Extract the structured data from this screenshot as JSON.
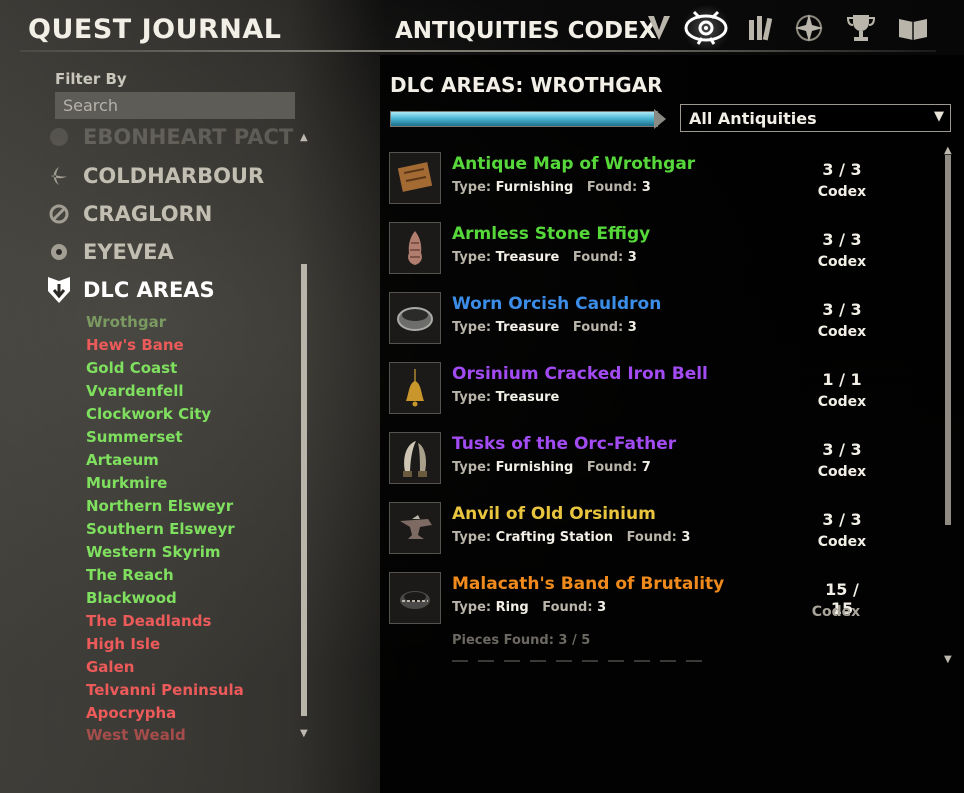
{
  "header": {
    "title": "QUEST JOURNAL",
    "codex_title": "ANTIQUITIES CODEX",
    "tabs": [
      {
        "icon": "quest-shield-icon"
      },
      {
        "icon": "antiquities-eye-icon",
        "active": true
      },
      {
        "icon": "lore-books-icon"
      },
      {
        "icon": "compass-star-icon"
      },
      {
        "icon": "trophy-icon"
      },
      {
        "icon": "open-book-icon"
      }
    ]
  },
  "filter": {
    "label": "Filter By",
    "search_placeholder": "Search"
  },
  "categories": [
    {
      "label": "EBONHEART PACT",
      "icon": "ebonheart-icon",
      "state": "faded"
    },
    {
      "label": "COLDHARBOUR",
      "icon": "coldharbour-icon"
    },
    {
      "label": "CRAGLORN",
      "icon": "craglorn-icon"
    },
    {
      "label": "EYEVEA",
      "icon": "eyevea-icon"
    },
    {
      "label": "DLC AREAS",
      "icon": "dlc-shield-icon",
      "state": "selected"
    }
  ],
  "zones": [
    {
      "label": "Wrothgar",
      "color": "selected"
    },
    {
      "label": "Hew's Bane",
      "color": "red"
    },
    {
      "label": "Gold Coast",
      "color": "green"
    },
    {
      "label": "Vvardenfell",
      "color": "green"
    },
    {
      "label": "Clockwork City",
      "color": "green"
    },
    {
      "label": "Summerset",
      "color": "green"
    },
    {
      "label": "Artaeum",
      "color": "green"
    },
    {
      "label": "Murkmire",
      "color": "green"
    },
    {
      "label": "Northern Elsweyr",
      "color": "green"
    },
    {
      "label": "Southern Elsweyr",
      "color": "green"
    },
    {
      "label": "Western Skyrim",
      "color": "green"
    },
    {
      "label": "The Reach",
      "color": "green"
    },
    {
      "label": "Blackwood",
      "color": "green"
    },
    {
      "label": "The Deadlands",
      "color": "red"
    },
    {
      "label": "High Isle",
      "color": "red"
    },
    {
      "label": "Galen",
      "color": "red"
    },
    {
      "label": "Telvanni Peninsula",
      "color": "red"
    },
    {
      "label": "Apocrypha",
      "color": "red"
    },
    {
      "label": "West Weald",
      "color": "red"
    }
  ],
  "main": {
    "section_title": "DLC AREAS: WROTHGAR",
    "progress_fraction": 1.0,
    "dropdown_value": "All Antiquities",
    "type_label": "Type:",
    "found_label": "Found:",
    "items": [
      {
        "name": "Antique Map of Wrothgar",
        "color": "#56d83a",
        "type": "Furnishing",
        "found": "3",
        "count": "3 / 3",
        "codex": "Codex",
        "thumb": "map-icon"
      },
      {
        "name": "Armless Stone Effigy",
        "color": "#56d83a",
        "type": "Treasure",
        "found": "3",
        "count": "3 / 3",
        "codex": "Codex",
        "thumb": "effigy-icon"
      },
      {
        "name": "Worn Orcish Cauldron",
        "color": "#3b8de8",
        "type": "Treasure",
        "found": "3",
        "count": "3 / 3",
        "codex": "Codex",
        "thumb": "cauldron-icon"
      },
      {
        "name": "Orsinium Cracked Iron Bell",
        "color": "#a24bf2",
        "type": "Treasure",
        "found": null,
        "count": "1 / 1",
        "codex": "Codex",
        "thumb": "bell-icon"
      },
      {
        "name": "Tusks of the Orc-Father",
        "color": "#a24bf2",
        "type": "Furnishing",
        "found": "7",
        "count": "3 / 3",
        "codex": "Codex",
        "thumb": "tusks-icon"
      },
      {
        "name": "Anvil of Old Orsinium",
        "color": "#e9c53f",
        "type": "Crafting Station",
        "found": "3",
        "count": "3 / 3",
        "codex": "Codex",
        "thumb": "anvil-icon"
      },
      {
        "name": "Malacath's Band of Brutality",
        "color": "#f08a1c",
        "type": "Ring",
        "found": "3",
        "count": "15 / 15",
        "codex": "Codex",
        "thumb": "ring-icon"
      }
    ],
    "pieces_found": "Pieces Found: 3 / 5"
  }
}
